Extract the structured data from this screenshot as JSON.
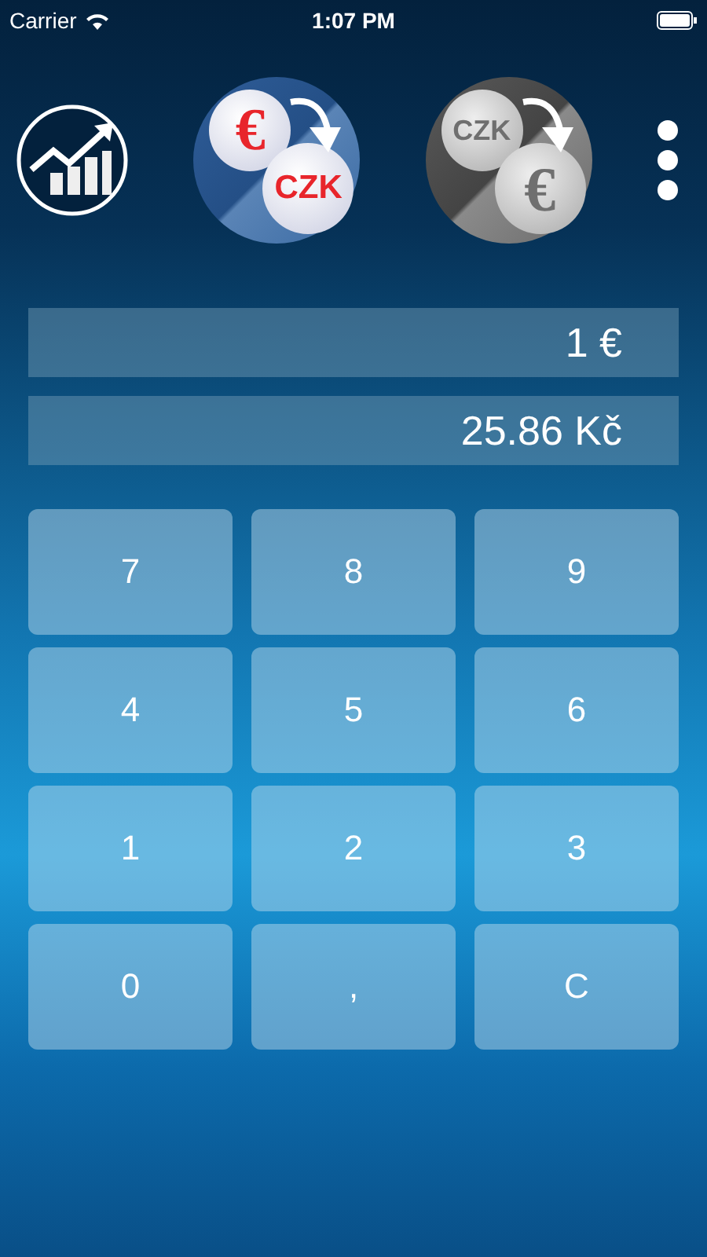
{
  "status_bar": {
    "carrier": "Carrier",
    "time": "1:07 PM"
  },
  "modes": [
    {
      "from": "€",
      "to": "CZK",
      "selected": true
    },
    {
      "from": "CZK",
      "to": "€",
      "selected": false
    }
  ],
  "display": {
    "input": "1 €",
    "result": "25.86 Kč"
  },
  "keys": [
    "7",
    "8",
    "9",
    "4",
    "5",
    "6",
    "1",
    "2",
    "3",
    "0",
    ",",
    "C"
  ]
}
